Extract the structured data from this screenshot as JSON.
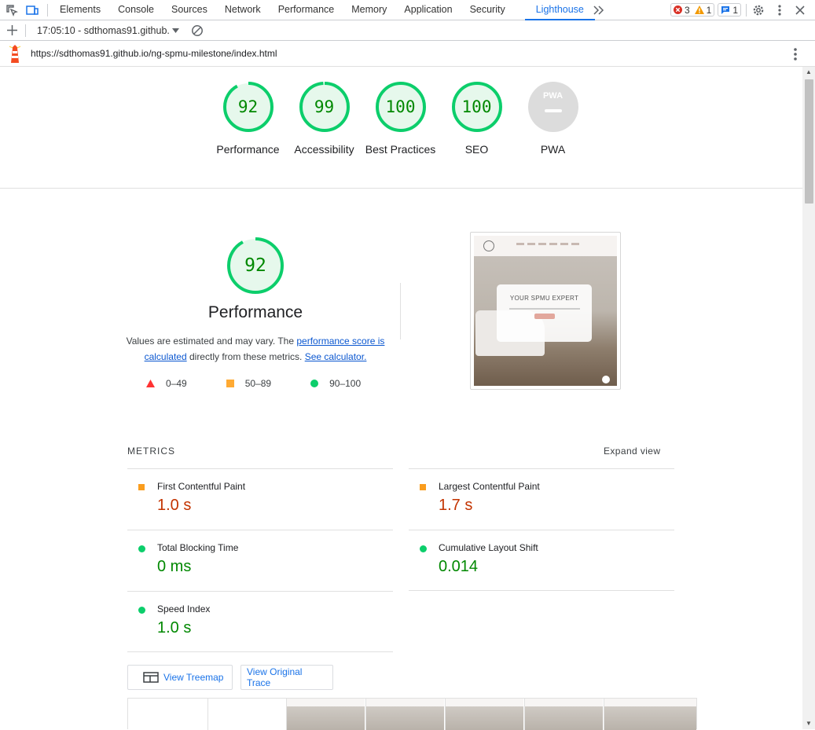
{
  "devtools": {
    "tabs": [
      "Elements",
      "Console",
      "Sources",
      "Network",
      "Performance",
      "Memory",
      "Application",
      "Security",
      "Lighthouse"
    ],
    "active_tab": "Lighthouse",
    "more_tabs_label": "»",
    "errors": "3",
    "warnings": "1",
    "messages": "1"
  },
  "report_bar": {
    "report_label": "17:05:10 - sdthomas91.github."
  },
  "url_bar": {
    "url": "https://sdthomas91.github.io/ng-spmu-milestone/index.html"
  },
  "gauges": [
    {
      "score": 92,
      "label": "Performance"
    },
    {
      "score": 99,
      "label": "Accessibility"
    },
    {
      "score": 100,
      "label": "Best Practices"
    },
    {
      "score": 100,
      "label": "SEO"
    },
    {
      "score": null,
      "label": "PWA",
      "badge": "PWA"
    }
  ],
  "performance": {
    "score": "92",
    "title": "Performance",
    "desc_prefix": "Values are estimated and may vary. The ",
    "desc_link1": "performance score is calculated",
    "desc_mid": " directly from these metrics. ",
    "desc_link2": "See calculator.",
    "legend": [
      {
        "range": "0–49",
        "color": "#ff3333"
      },
      {
        "range": "50–89",
        "color": "#ffaa33"
      },
      {
        "range": "90–100",
        "color": "#0cce6b"
      }
    ]
  },
  "screenshot": {
    "card_title": "YOUR SPMU EXPERT"
  },
  "metrics": {
    "header": "METRICS",
    "expand_label": "Expand view",
    "items": [
      {
        "name": "First Contentful Paint",
        "value": "1.0 s",
        "rating": "average"
      },
      {
        "name": "Largest Contentful Paint",
        "value": "1.7 s",
        "rating": "average"
      },
      {
        "name": "Total Blocking Time",
        "value": "0 ms",
        "rating": "pass"
      },
      {
        "name": "Cumulative Layout Shift",
        "value": "0.014",
        "rating": "pass"
      },
      {
        "name": "Speed Index",
        "value": "1.0 s",
        "rating": "pass"
      }
    ]
  },
  "buttons": {
    "treemap": "View Treemap",
    "trace": "View Original Trace"
  },
  "colors": {
    "pass": "#0cce6b",
    "pass_text": "#008800",
    "average": "#fa9d1e",
    "average_text": "#c33300",
    "accent": "#1a73e8"
  }
}
